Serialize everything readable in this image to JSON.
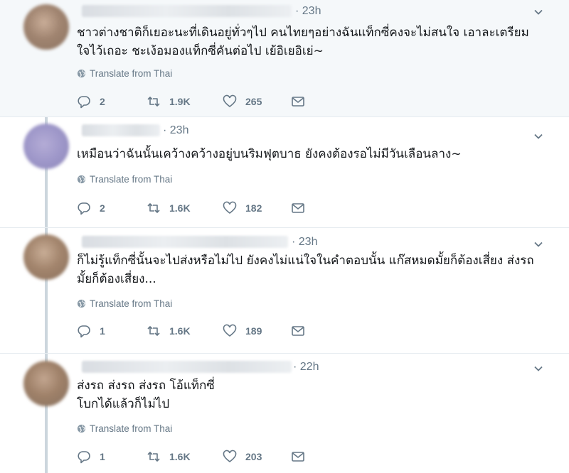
{
  "translate_label": "Translate from Thai",
  "tweets": [
    {
      "time": "· 23h",
      "lines": [
        "ชาวต่างชาติก็เยอะนะที่เดินอยู่ทั่วๆไป คนไทยๆอย่างฉันแท็กซี่คงจะไม่สนใจ เอาละเตรียม",
        "ใจไว้เถอะ ชะเง้อมองแท็กซี่คันต่อไป เย้อิเยอิเย่~"
      ],
      "replies": "2",
      "retweets": "1.9K",
      "likes": "265"
    },
    {
      "time": "· 23h",
      "lines": [
        "เหมือนว่าฉันนั้นเคว้างคว้างอยู่บนริมฟุตบาธ ยังคงต้องรอไม่มีวันเลือนลาง~"
      ],
      "replies": "2",
      "retweets": "1.6K",
      "likes": "182"
    },
    {
      "time": "· 23h",
      "lines": [
        "ก็ไม่รู้แท็กซี่นั้นจะไปส่งหรือไม่ไป ยังคงไม่แน่ใจในคำตอบนั้น แก๊สหมดมั้ยก็ต้องเสี่ยง ส่งรถ",
        "มั้ยก็ต้องเสี่ยง..."
      ],
      "replies": "1",
      "retweets": "1.6K",
      "likes": "189"
    },
    {
      "time": "· 22h",
      "lines": [
        "ส่งรถ ส่งรถ ส่งรถ โอ้แท็กซี่",
        "โบกได้แล้วก็ไม่ไป"
      ],
      "replies": "1",
      "retweets": "1.6K",
      "likes": "203"
    }
  ]
}
